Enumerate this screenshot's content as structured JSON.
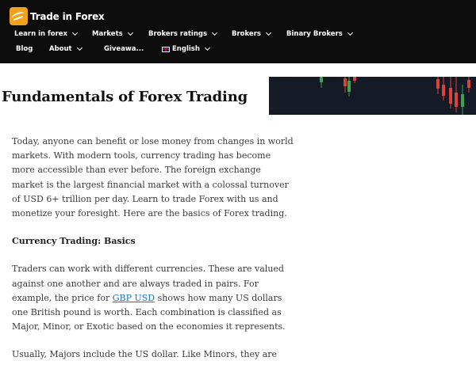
{
  "header": {
    "logo_text": "Trade in Forex",
    "nav_row1": [
      {
        "label": "Learn in forex",
        "has_dropdown": true
      },
      {
        "label": "Markets",
        "has_dropdown": true
      },
      {
        "label": "Brokers ratings",
        "has_dropdown": true
      },
      {
        "label": "Brokers",
        "has_dropdown": true
      },
      {
        "label": "Binary Brokers",
        "has_dropdown": true
      }
    ],
    "nav_row2": [
      {
        "label": "Blog",
        "has_dropdown": false
      },
      {
        "label": "About",
        "has_dropdown": true
      },
      {
        "label": "Giveawa...",
        "has_dropdown": false
      },
      {
        "label": "English",
        "has_dropdown": true,
        "flag": "uk-flag"
      }
    ]
  },
  "page": {
    "title": "Fundamentals of Forex Trading",
    "intro": "Today, anyone can benefit or lose money from changes in world markets. With modern tools, currency trading has become more accessible than ever before. The foreign exchange market is the largest financial market with a colossal turnover of USD 6+ trillion per day. Learn to trade Forex with us and monetize your foresight. Here are the basics of Forex trading.",
    "section_heading": "Currency Trading: Basics",
    "para2_before": "Traders can work with different currencies. These are valued against one another and are always traded in pairs. For example, the price for ",
    "para2_link": "GBP USD",
    "para2_after": " shows how many US dollars one British pound is worth. Each combination is classified as Major, Minor, or Exotic based on the economies it represents.",
    "para3": "Usually, Majors include the US dollar. Like Minors, they are"
  },
  "colors": {
    "header_bg": "#0d0d0e",
    "logo_accent": "#f0a21f",
    "link": "#1e73be",
    "banner_bg": "#151a27"
  }
}
